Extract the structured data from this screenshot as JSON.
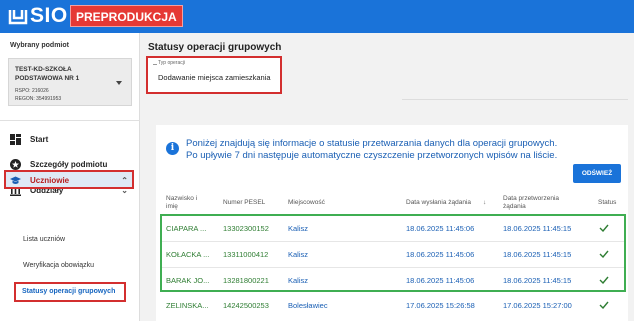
{
  "app": {
    "logo_text": "SIO",
    "env_badge": "PREPRODUKCJA"
  },
  "sidebar": {
    "heading": "Wybrany podmiot",
    "school": {
      "name": "TEST-KD-SZKOŁA PODSTAWOWA NR 1",
      "rspo": "RSPO: 216026",
      "regon": "REGON: 354991953"
    },
    "nav": [
      {
        "label": "Start",
        "icon": "dashboard-icon"
      },
      {
        "label": "Szczegóły podmiotu",
        "icon": "star-icon"
      },
      {
        "label": "Oddziały",
        "icon": "building-icon"
      },
      {
        "label": "Uczniowie",
        "icon": "graduation-cap-icon"
      }
    ],
    "sub_items": [
      {
        "label": "Lista uczniów"
      },
      {
        "label": "Weryfikacja obowiązku"
      },
      {
        "label": "Statusy operacji grupowych"
      }
    ]
  },
  "main": {
    "title": "Statusy operacji grupowych",
    "operation_type": {
      "label": "Typ operacji",
      "value": "Dodawanie miejsca zamieszkania"
    },
    "info_line1": "Poniżej znajdują się informacje o statusie przetwarzania danych dla operacji grupowych.",
    "info_line2": "Po upływie 7 dni następuje automatyczne czyszczenie przetworzonych wpisów na liście.",
    "refresh_label": "ODŚWIEŻ",
    "columns": {
      "name": "Nazwisko i imię",
      "pesel": "Numer PESEL",
      "city": "Miejscowość",
      "sent": "Data wysłania żądania",
      "sort_arrow": "↓",
      "processed": "Data przetworzenia żądania",
      "status": "Status"
    },
    "rows": [
      {
        "name": "CIAPARA ...",
        "pesel": "13302300152",
        "city": "Kalisz",
        "sent": "18.06.2025 11:45:06",
        "processed": "18.06.2025 11:45:15"
      },
      {
        "name": "KOŁACKA ...",
        "pesel": "13311000412",
        "city": "Kalisz",
        "sent": "18.06.2025 11:45:06",
        "processed": "18.06.2025 11:45:15"
      },
      {
        "name": "BARAK JO...",
        "pesel": "13281800221",
        "city": "Kalisz",
        "sent": "18.06.2025 11:45:06",
        "processed": "18.06.2025 11:45:15"
      },
      {
        "name": "ZELINSKA...",
        "pesel": "14242500253",
        "city": "Bolesławiec",
        "sent": "17.06.2025 15:26:58",
        "processed": "17.06.2025 15:27:00"
      }
    ]
  },
  "colors": {
    "brand": "#1a73d9",
    "badge": "#e53935",
    "highlight": "#d32f2f",
    "success": "#3fae52"
  }
}
